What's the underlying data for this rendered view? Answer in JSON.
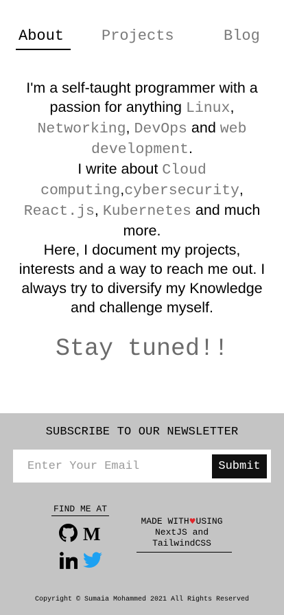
{
  "nav": {
    "tabs": [
      {
        "label": "About",
        "active": true
      },
      {
        "label": "Projects",
        "active": false
      },
      {
        "label": "Blog",
        "active": false
      }
    ]
  },
  "bio": {
    "p1_text1": "I'm a self-taught programmer with a passion for anything ",
    "linux": "Linux",
    "comma1": ",",
    "networking": "Networking",
    "comma2": ",",
    "devops": "DevOps",
    "and1": " and ",
    "webdev": "web development",
    "period1": ".",
    "p2_text1": "I write about ",
    "cloud": "Cloud computing",
    "comma3": ",",
    "cyber": "cybersecurity",
    "comma4": ",",
    "react": "React.js",
    "comma5": ",",
    "k8s": "Kubernetes",
    "p2_text2": " and much more.",
    "p3": "Here, I document my projects, interests and a way to reach me out. I always try to diversify my Knowledge and challenge myself."
  },
  "stay_tuned": "Stay tuned!!",
  "newsletter": {
    "title": "SUBSCRIBE TO OUR NEWSLETTER",
    "placeholder": "Enter Your Email",
    "submit_label": "Submit"
  },
  "find_me": {
    "label": "FIND ME AT",
    "icons": [
      "github-icon",
      "medium-icon",
      "linkedin-icon",
      "twitter-icon"
    ]
  },
  "made_with": {
    "prefix": "MADE WITH",
    "heart": "♥",
    "suffix": "USING",
    "line2": "NextJS and",
    "line3": "TailwindCSS"
  },
  "copyright": "Copyright © Sumaia Mohammed 2021 All Rights Reserved",
  "colors": {
    "accent_gray": "#7a7a7a",
    "footer_bg": "#c4c4c4",
    "twitter_blue": "#1da1f2",
    "heart_red": "#e0262b"
  }
}
